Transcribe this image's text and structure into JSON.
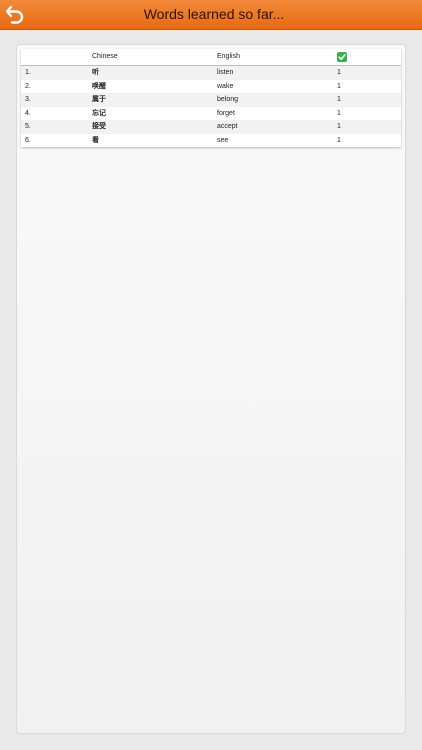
{
  "header": {
    "title": "Words learned so far...",
    "back_icon": "back-arrow-icon",
    "accent_color": "#e8731a"
  },
  "table": {
    "columns": [
      "",
      "Chinese",
      "English",
      "check-icon"
    ],
    "rows": [
      {
        "num": "1.",
        "chinese": "听",
        "english": "listen",
        "count": "1"
      },
      {
        "num": "2.",
        "chinese": "唤醒",
        "english": "wake",
        "count": "1"
      },
      {
        "num": "3.",
        "chinese": "属于",
        "english": "belong",
        "count": "1"
      },
      {
        "num": "4.",
        "chinese": "忘记",
        "english": "forget",
        "count": "1"
      },
      {
        "num": "5.",
        "chinese": "接受",
        "english": "accept",
        "count": "1"
      },
      {
        "num": "6.",
        "chinese": "看",
        "english": "see",
        "count": "1"
      }
    ],
    "check_color": "#35b34a"
  }
}
